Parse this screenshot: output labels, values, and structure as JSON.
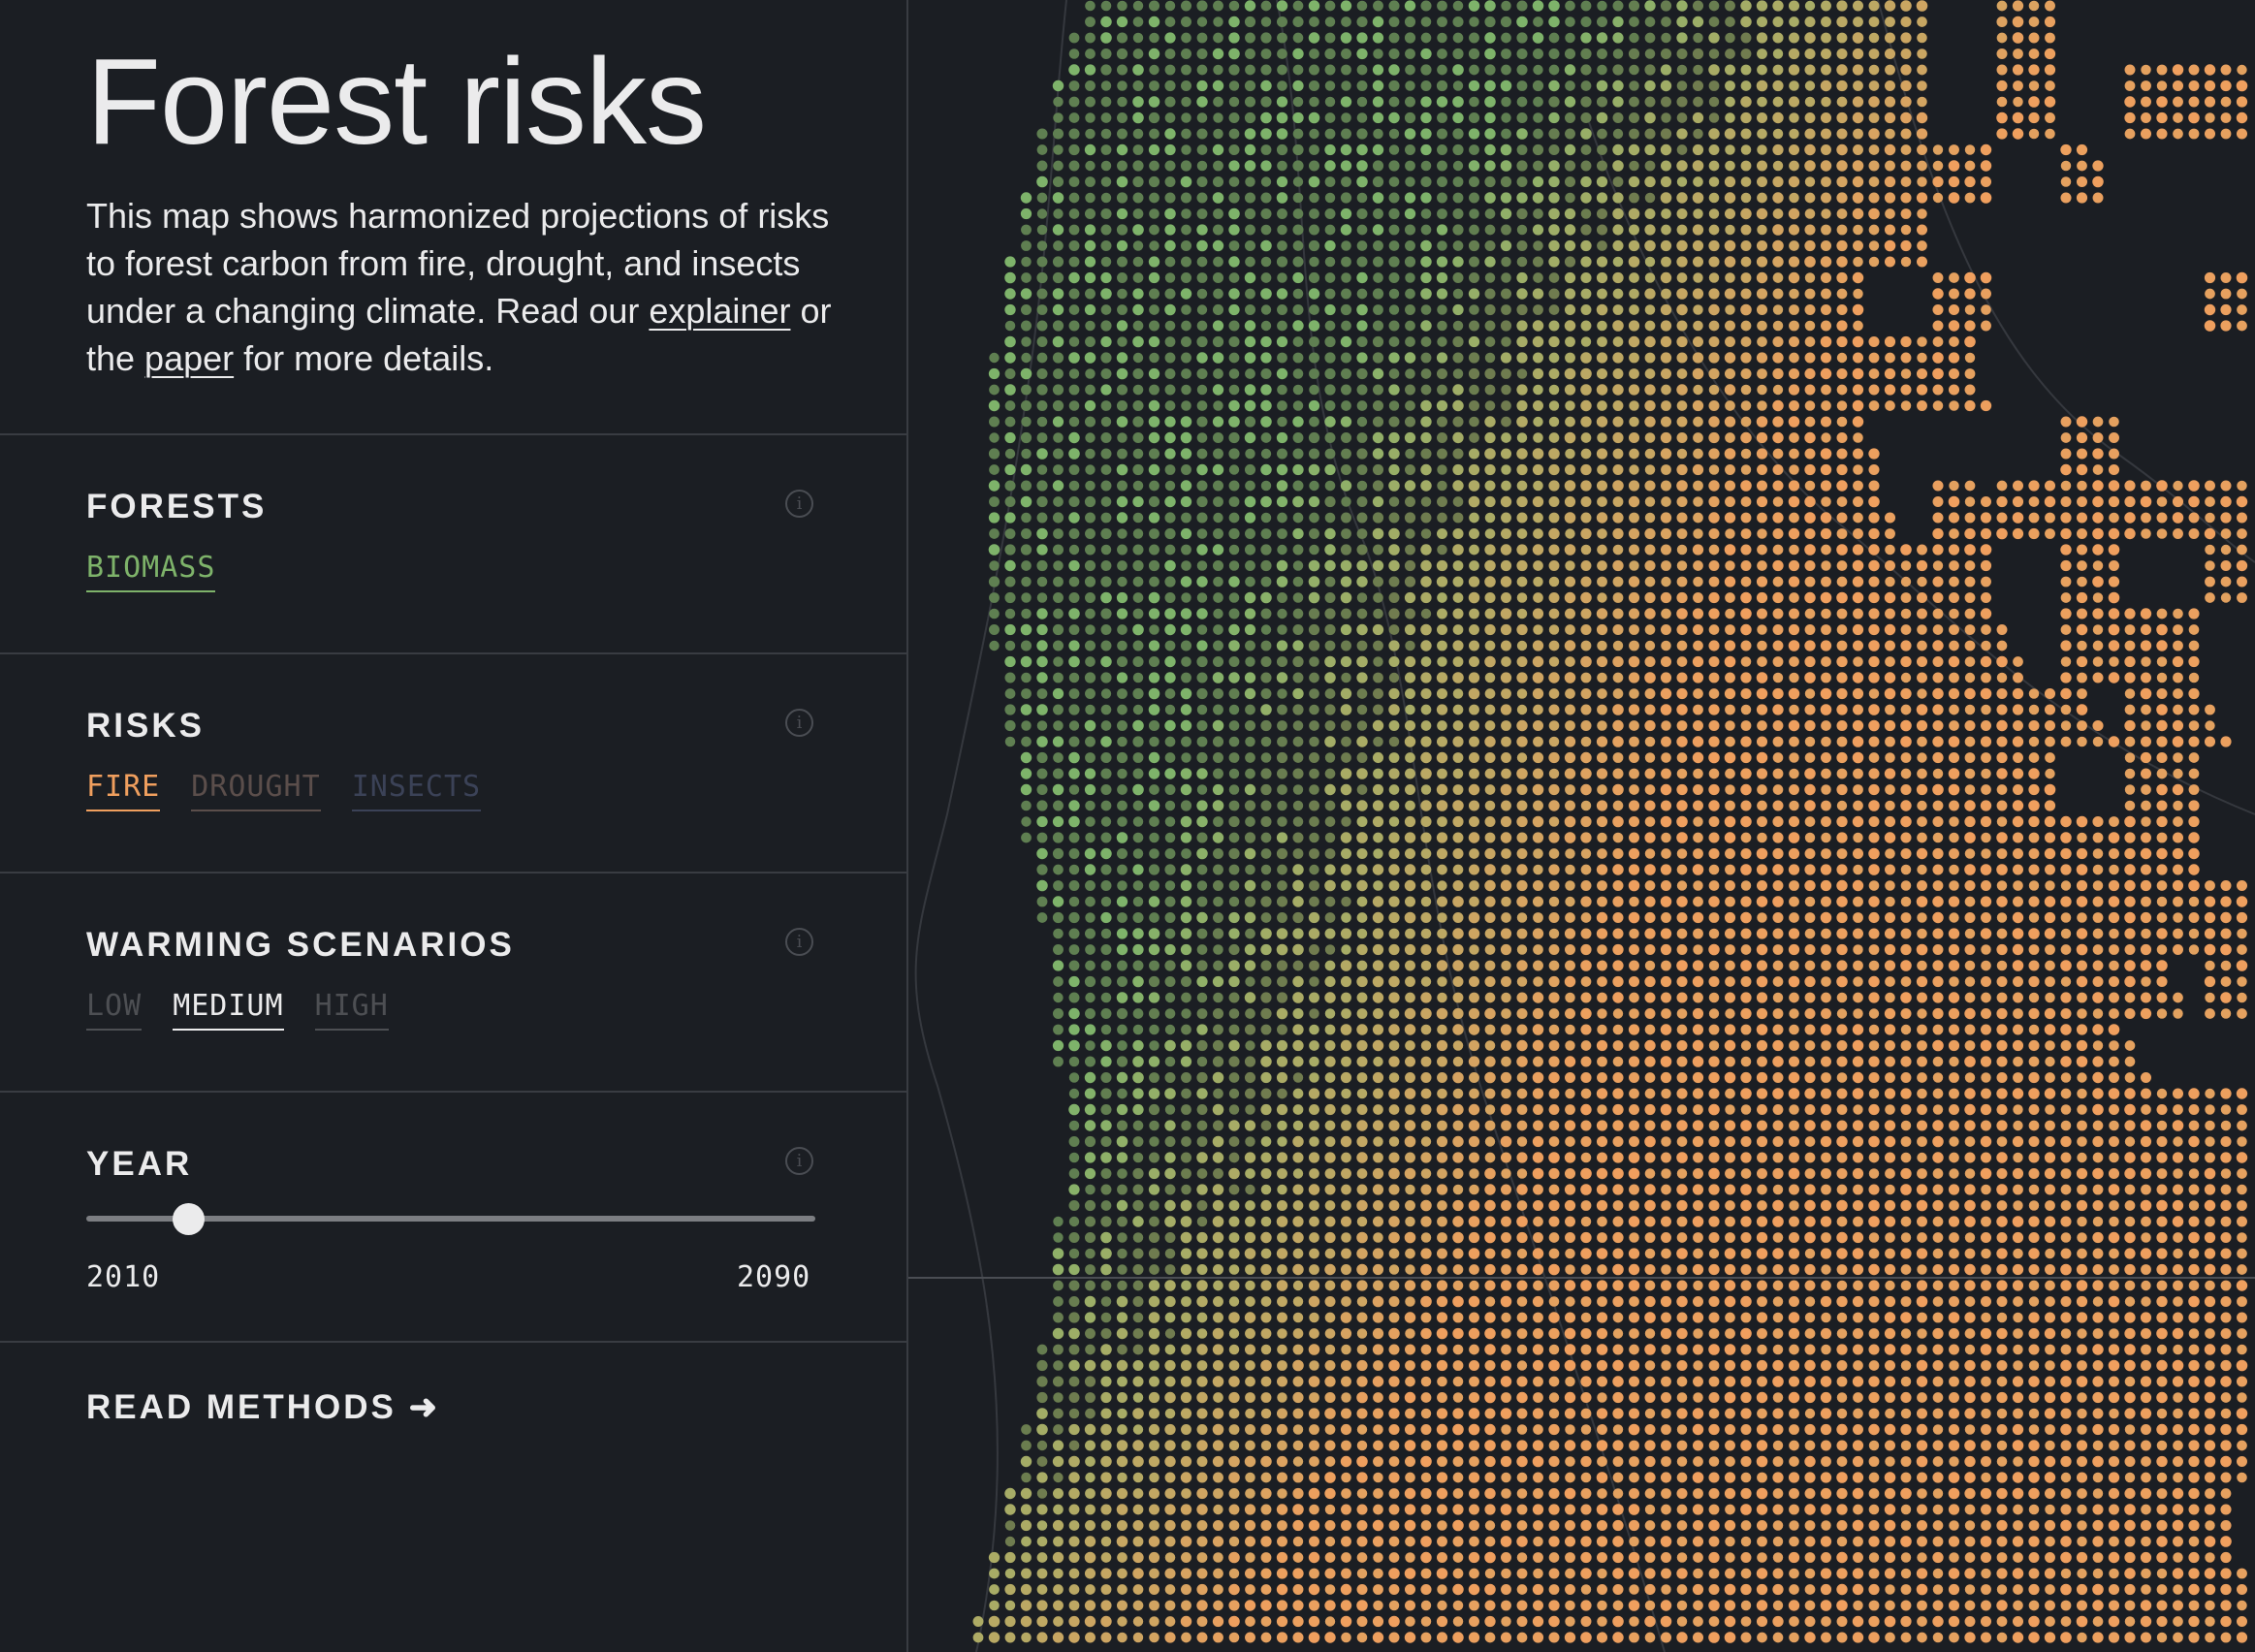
{
  "sidebar": {
    "title": "Forest risks",
    "intro": {
      "text_before": "This map shows harmonized projections of risks to forest carbon from fire, drought, and insects under a changing climate. Read our ",
      "link_explainer": "explainer",
      "text_middle": " or the ",
      "link_paper": "paper",
      "text_after": " for more details."
    },
    "sections": {
      "forests": {
        "title": "FORESTS",
        "options": [
          "BIOMASS"
        ],
        "selected": "BIOMASS"
      },
      "risks": {
        "title": "RISKS",
        "options": [
          "FIRE",
          "DROUGHT",
          "INSECTS"
        ],
        "selected": "FIRE"
      },
      "warming": {
        "title": "WARMING SCENARIOS",
        "options": [
          "LOW",
          "MEDIUM",
          "HIGH"
        ],
        "selected": "MEDIUM"
      },
      "year": {
        "title": "YEAR",
        "min": "2010",
        "max": "2090",
        "value_fraction": 0.14
      }
    },
    "read_methods": "READ METHODS",
    "info_icon": "i"
  },
  "colors": {
    "background": "#1b1e23",
    "text": "#ebebec",
    "biomass": "#7eb36a",
    "fire": "#f09f5e",
    "drought": "#5b4e4b",
    "insects": "#3b4257",
    "inactive": "#4d4f53",
    "divider": "#393c42"
  },
  "icons": {
    "info": "info-circle-icon",
    "arrow": "arrow-right-icon"
  }
}
